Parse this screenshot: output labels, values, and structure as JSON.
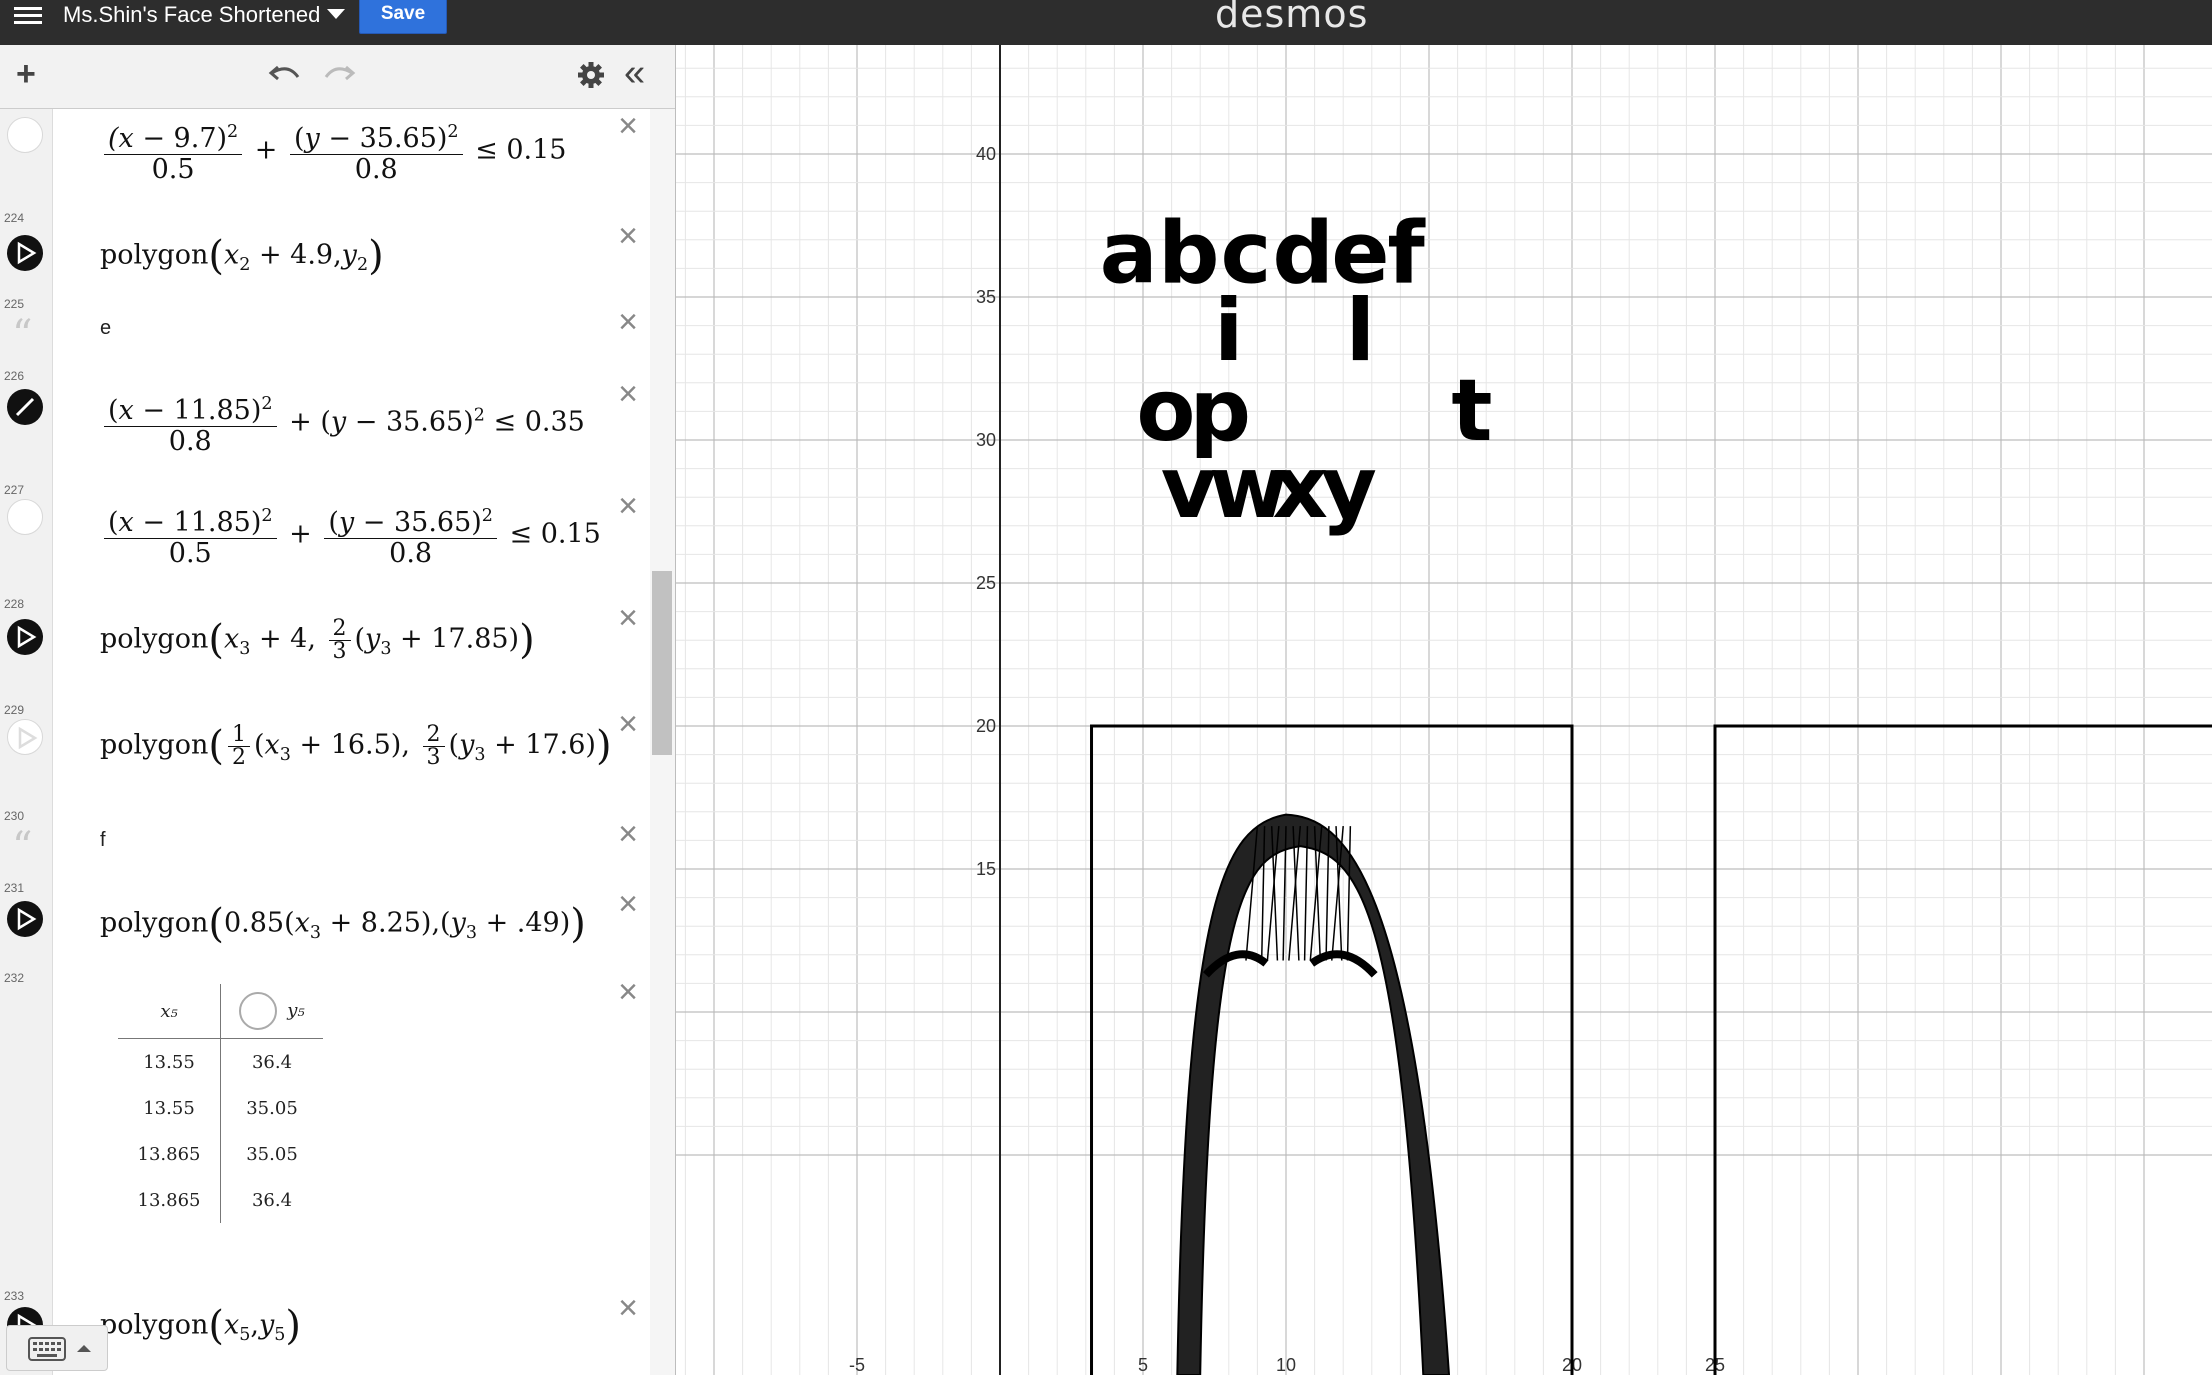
{
  "header": {
    "graph_title": "Ms.Shin's Face Shortened",
    "save_label": "Save",
    "brand": "desmos"
  },
  "expressions": [
    {
      "id": "expr-223-partial",
      "num": "",
      "type": "inequality",
      "display": "(x−9.7)²/0.5 + (y−35.65)²/0.8 ≤ 0.15"
    },
    {
      "id": "expr-224",
      "num": "224",
      "type": "polygon",
      "display": "polygon(x₂ + 4.9,y₂)"
    },
    {
      "id": "expr-225",
      "num": "225",
      "type": "note",
      "text": "e"
    },
    {
      "id": "expr-226",
      "num": "226",
      "type": "inequality",
      "display": "(x−11.85)²/0.8 + (y−35.65)² ≤ 0.35"
    },
    {
      "id": "expr-227",
      "num": "227",
      "type": "inequality",
      "display": "(x−11.85)²/0.5 + (y−35.65)²/0.8 ≤ 0.15"
    },
    {
      "id": "expr-228",
      "num": "228",
      "type": "polygon",
      "display": "polygon(x₃ + 4, 2/3(y₃ + 17.85))"
    },
    {
      "id": "expr-229",
      "num": "229",
      "type": "polygon",
      "display": "polygon(1/2(x₃ + 16.5), 2/3(y₃ + 17.6))"
    },
    {
      "id": "expr-230",
      "num": "230",
      "type": "note",
      "text": "f"
    },
    {
      "id": "expr-231",
      "num": "231",
      "type": "polygon",
      "display": "polygon(0.85(x₃ + 8.25), (y₃ + .49))"
    },
    {
      "id": "expr-232",
      "num": "232",
      "type": "table",
      "columns": [
        "x₅",
        "y₅"
      ],
      "rows": [
        [
          "13.55",
          "36.4"
        ],
        [
          "13.55",
          "35.05"
        ],
        [
          "13.865",
          "35.05"
        ],
        [
          "13.865",
          "36.4"
        ]
      ]
    },
    {
      "id": "expr-233",
      "num": "233",
      "type": "polygon",
      "display": "polygon(x₅,y₅)"
    }
  ],
  "graph": {
    "x_ticks": [
      "-5",
      "5",
      "10",
      "20",
      "25"
    ],
    "y_ticks": [
      "40",
      "35",
      "30",
      "25",
      "20",
      "15"
    ],
    "letters_row1": [
      "a",
      "b",
      "c",
      "d",
      "e",
      "f"
    ],
    "letters_row2": [
      "i",
      "l"
    ],
    "letters_row3": [
      "o",
      "p",
      "t"
    ],
    "letters_row4": [
      "v",
      "w",
      "x",
      "y"
    ]
  },
  "colors": {
    "topbar": "#2d2d2d",
    "save_button": "#2f72dc",
    "grid_minor": "#e6e6e6",
    "grid_major": "#bdbdbd"
  }
}
